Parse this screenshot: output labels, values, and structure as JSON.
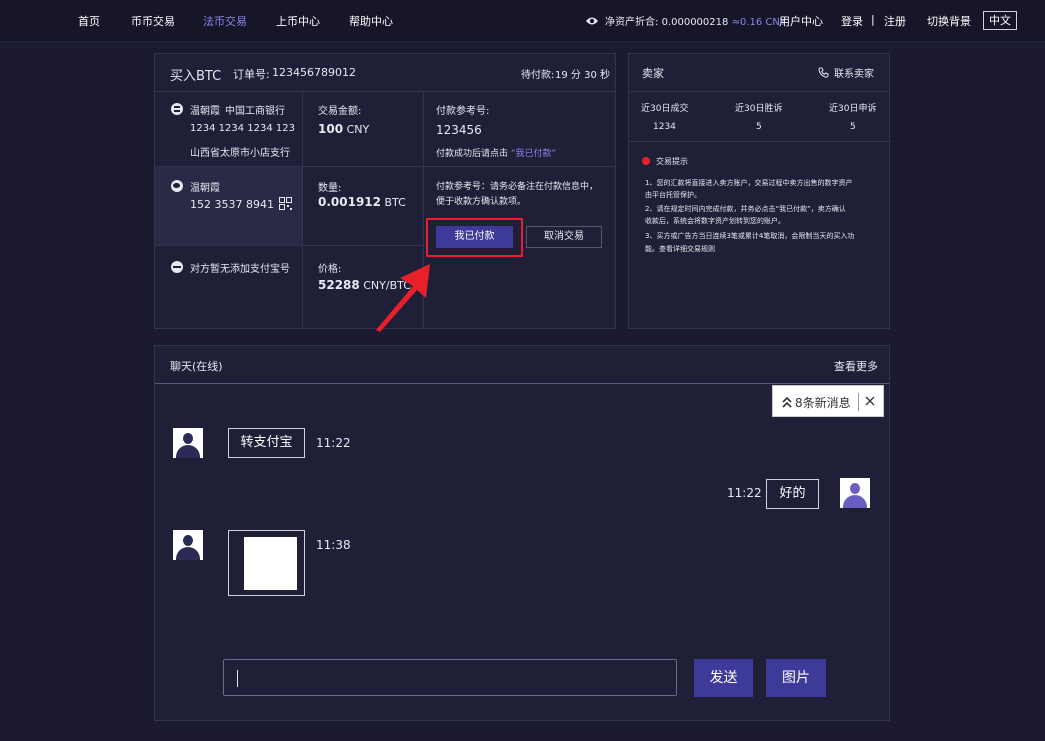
{
  "nav": {
    "home": "首页",
    "coin_trade": "币币交易",
    "fiat_trade": "法币交易",
    "listing": "上币中心",
    "help": "帮助中心"
  },
  "assets": {
    "label": "净资产折合:",
    "value": "0.000000218",
    "cny": "≈0.16 CNY"
  },
  "user": {
    "center": "用户中心",
    "login": "登录",
    "sep": "|",
    "register": "注册",
    "switch_bg": "切换背景",
    "lang": "中文"
  },
  "order": {
    "title": "买入BTC",
    "order_no_label": "订单号:",
    "order_no": "123456789012",
    "pending_label": "待付款:",
    "pending_time": "19 分 30 秒",
    "bank": {
      "name": "温朝霞",
      "bank_name": "中国工商银行",
      "account": "1234 1234 1234 123",
      "branch": "山西省太原市小店支行"
    },
    "wechat": {
      "name": "温朝霞",
      "phone": "152 3537 8941"
    },
    "alipay_none": "对方暂无添加支付宝号",
    "amount_label": "交易金额:",
    "amount_value": "100",
    "amount_unit": "CNY",
    "qty_label": "数量:",
    "qty_value": "0.001912",
    "qty_unit": "BTC",
    "price_label": "价格:",
    "price_value": "52288",
    "price_unit": "CNY/BTC",
    "ref_label": "付款参考号:",
    "ref_value": "123456",
    "ref_hint_prefix": "付款成功后请点击",
    "ref_hint_link": "“我已付款”",
    "note_line1": "付款参考号：请务必备注在付款信息中，",
    "note_line2": "便于收款方确认款项。",
    "paid_button": "我已付款",
    "cancel_button": "取消交易"
  },
  "seller": {
    "title": "卖家",
    "contact": "联系卖家",
    "stats_headers": [
      "近30日成交",
      "近30日胜诉",
      "近30日申诉"
    ],
    "stats_values": [
      "1234",
      "5",
      "5"
    ],
    "tips_title": "交易提示",
    "tips": [
      "1、您的汇款将直接进入卖方账户，交易过程中卖方出售的数字资产",
      "由平台托管保护。",
      "2、请在规定时间内完成付款，并务必点击“我已付款”，卖方确认",
      "收款后，系统会将数字资产划转到您的账户。",
      "3、买方或广告方当日连续3笔或累计4笔取消，会限制当天的买入功",
      "能。查看详细交易规则"
    ]
  },
  "chat": {
    "title": "聊天(在线)",
    "more": "查看更多",
    "new_messages": "8条新消息",
    "messages": [
      {
        "text": "转支付宝",
        "time": "11:22"
      },
      {
        "text": "好的",
        "time": "11:22"
      },
      {
        "text": "",
        "time": "11:38"
      }
    ],
    "input_value": "",
    "send": "发送",
    "image": "图片"
  },
  "colors": {
    "accent": "#8d84e8",
    "primary_button": "#3d3a99",
    "highlight": "#e8202a",
    "background": "#1b1a30"
  }
}
